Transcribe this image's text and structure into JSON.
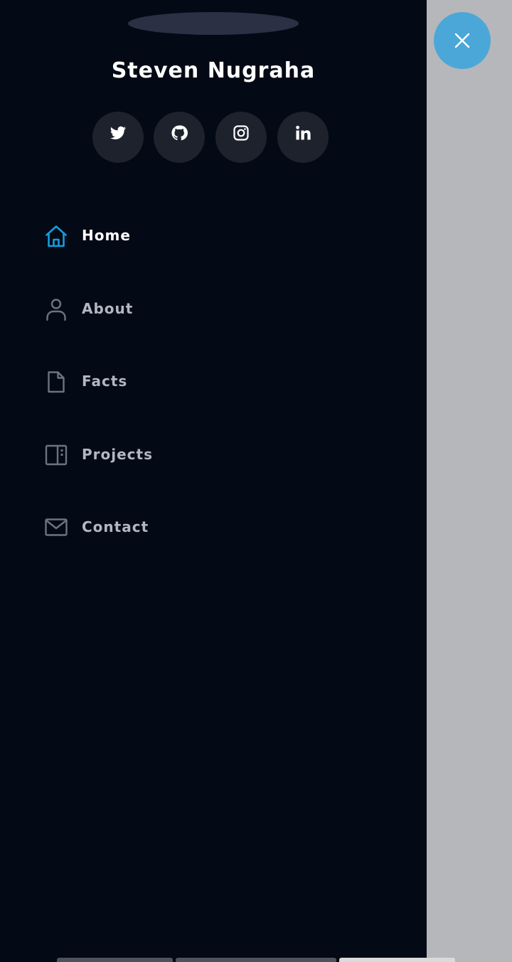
{
  "profile": {
    "name": "Steven Nugraha"
  },
  "social": [
    {
      "icon": "twitter-icon"
    },
    {
      "icon": "github-icon"
    },
    {
      "icon": "instagram-icon"
    },
    {
      "icon": "linkedin-icon"
    }
  ],
  "nav": {
    "items": [
      {
        "label": "Home",
        "icon": "home-icon",
        "active": true
      },
      {
        "label": "About",
        "icon": "person-icon",
        "active": false
      },
      {
        "label": "Facts",
        "icon": "file-icon",
        "active": false
      },
      {
        "label": "Projects",
        "icon": "layout-icon",
        "active": false
      },
      {
        "label": "Contact",
        "icon": "envelope-icon",
        "active": false
      }
    ]
  },
  "colors": {
    "drawer_bg": "#030a15",
    "backdrop": "#b6b7bb",
    "accent": "#4ba7d8",
    "active_icon": "#149ddd",
    "inactive_text": "#b2b7c2",
    "social_bg": "#1e222d"
  },
  "close_button": {
    "icon": "close-icon"
  }
}
